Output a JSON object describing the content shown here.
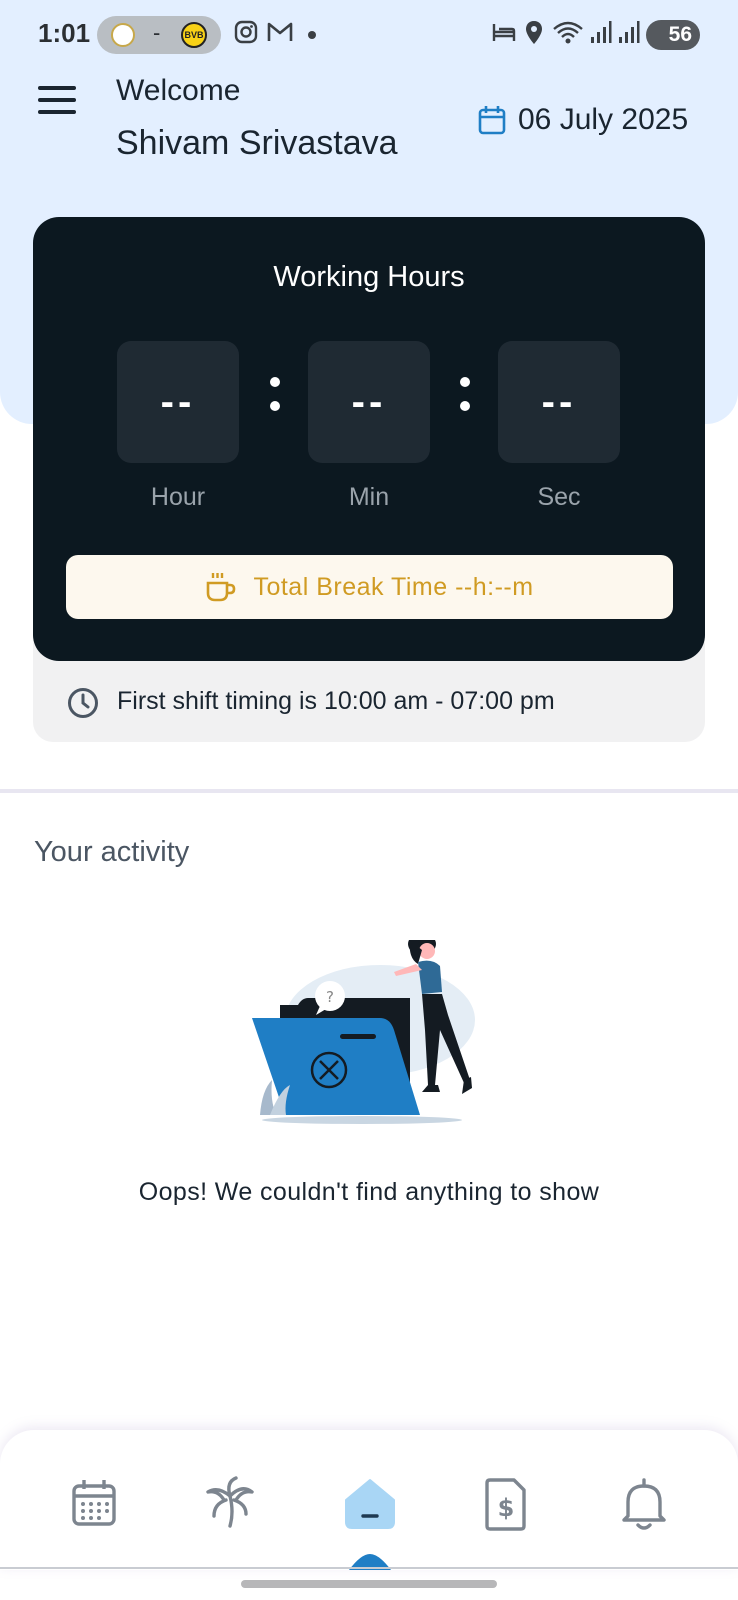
{
  "status_bar": {
    "time": "1:01",
    "pill_separator": "-",
    "team_badge": "BVB",
    "battery": "56",
    "icons": [
      "real-madrid-crest-icon",
      "bvb-crest-icon",
      "instagram-icon",
      "gmail-icon",
      "bed-icon",
      "location-icon",
      "wifi-icon",
      "signal-icon",
      "signal-icon",
      "battery-icon"
    ]
  },
  "header": {
    "welcome": "Welcome",
    "user_name": "Shivam Srivastava",
    "date": "06 July 2025",
    "icons": [
      "menu-icon",
      "calendar-icon"
    ]
  },
  "working_hours": {
    "title": "Working Hours",
    "hour_value": "--",
    "min_value": "--",
    "sec_value": "--",
    "hour_label": "Hour",
    "min_label": "Min",
    "sec_label": "Sec",
    "break_text": "Total Break Time --h:--m",
    "shift_text": "First shift timing is 10:00 am - 07:00 pm"
  },
  "activity": {
    "title": "Your activity",
    "empty_message": "Oops! We couldn't find anything to show"
  },
  "bottom_nav": {
    "items": [
      "calendar-grid-icon",
      "palm-tree-icon",
      "home-icon",
      "invoice-dollar-icon",
      "bell-icon"
    ],
    "active_index": 2
  },
  "colors": {
    "hero_bg": "#e3efff",
    "card_dark": "#0c1820",
    "break_accent": "#d09b23",
    "active_nav": "#a9d6f5",
    "illustration_blue": "#1f7ec5"
  }
}
